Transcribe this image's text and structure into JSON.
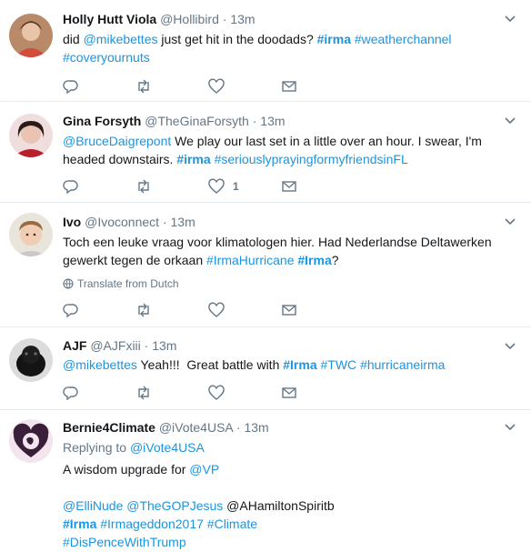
{
  "colors": {
    "link": "#1b95e0",
    "muted": "#657786",
    "border": "#e6ecf0",
    "text": "#14171a"
  },
  "tweets": [
    {
      "name": "Holly Hutt Viola",
      "handle": "@Hollibird",
      "time": "13m",
      "text_parts": [
        "did ",
        "@mikebettes",
        " just get hit in the doodads? ",
        "#irma",
        " ",
        "#weatherchannel",
        " ",
        "#coveryournuts"
      ],
      "actions": {
        "like_count": ""
      }
    },
    {
      "name": "Gina Forsyth",
      "handle": "@TheGinaForsyth",
      "time": "13m",
      "text_parts": [
        "@BruceDaigrepont",
        " We play our last set in a little over an hour. I swear, I'm headed downstairs. ",
        "#irma",
        " ",
        "#seriouslyprayingformyfriendsinFL"
      ],
      "actions": {
        "like_count": "1"
      }
    },
    {
      "name": "Ivo",
      "handle": "@Ivoconnect",
      "time": "13m",
      "text_parts": [
        "Toch een leuke vraag voor klimatologen hier. Had Nederlandse Deltawerken gewerkt tegen de orkaan ",
        "#IrmaHurricane",
        " ",
        "#Irma",
        "?"
      ],
      "translate_label": "Translate from Dutch",
      "actions": {
        "like_count": ""
      }
    },
    {
      "name": "AJF",
      "handle": "@AJFxiii",
      "time": "13m",
      "text_parts": [
        "@mikebettes",
        " Yeah!!!  Great battle with ",
        "#Irma",
        " ",
        "#TWC",
        " ",
        "#hurricaneirma"
      ],
      "actions": {
        "like_count": ""
      }
    },
    {
      "name": "Bernie4Climate",
      "handle": "@iVote4USA",
      "time": "13m",
      "replying_prefix": "Replying to ",
      "replying_handle": "@iVote4USA",
      "line1_parts": [
        "A wisdom upgrade for ",
        "@VP"
      ],
      "line2_parts": [
        "@ElliNude",
        " ",
        "@TheGOPJesus",
        " @AHamiltonSpiritb"
      ],
      "line3_parts": [
        "#Irma",
        " ",
        "#Irmageddon2017",
        " ",
        "#Climate"
      ],
      "line4_parts": [
        "#DisPenceWithTrump"
      ]
    }
  ],
  "separator": "·"
}
